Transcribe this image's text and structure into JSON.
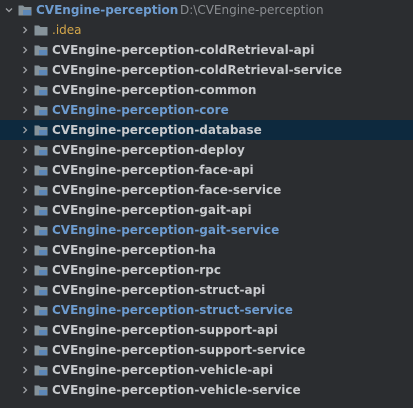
{
  "root": {
    "name": "CVEngine-perception",
    "path": "D:\\CVEngine-perception"
  },
  "items": [
    {
      "label": ".idea",
      "style": "orange",
      "selected": false
    },
    {
      "label": "CVEngine-perception-coldRetrieval-api",
      "style": "normal",
      "selected": false
    },
    {
      "label": "CVEngine-perception-coldRetrieval-service",
      "style": "normal",
      "selected": false
    },
    {
      "label": "CVEngine-perception-common",
      "style": "normal",
      "selected": false
    },
    {
      "label": "CVEngine-perception-core",
      "style": "blue",
      "selected": false
    },
    {
      "label": "CVEngine-perception-database",
      "style": "normal",
      "selected": true
    },
    {
      "label": "CVEngine-perception-deploy",
      "style": "normal",
      "selected": false
    },
    {
      "label": "CVEngine-perception-face-api",
      "style": "normal",
      "selected": false
    },
    {
      "label": "CVEngine-perception-face-service",
      "style": "normal",
      "selected": false
    },
    {
      "label": "CVEngine-perception-gait-api",
      "style": "normal",
      "selected": false
    },
    {
      "label": "CVEngine-perception-gait-service",
      "style": "blue",
      "selected": false
    },
    {
      "label": "CVEngine-perception-ha",
      "style": "normal",
      "selected": false
    },
    {
      "label": "CVEngine-perception-rpc",
      "style": "normal",
      "selected": false
    },
    {
      "label": "CVEngine-perception-struct-api",
      "style": "normal",
      "selected": false
    },
    {
      "label": "CVEngine-perception-struct-service",
      "style": "blue",
      "selected": false
    },
    {
      "label": "CVEngine-perception-support-api",
      "style": "normal",
      "selected": false
    },
    {
      "label": "CVEngine-perception-support-service",
      "style": "normal",
      "selected": false
    },
    {
      "label": "CVEngine-perception-vehicle-api",
      "style": "normal",
      "selected": false
    },
    {
      "label": "CVEngine-perception-vehicle-service",
      "style": "normal",
      "selected": false
    }
  ],
  "icons": {
    "expand": "chevron-down-icon",
    "collapse": "chevron-right-icon",
    "folder": "module-folder-icon",
    "idea_folder": "folder-icon"
  },
  "colors": {
    "background": "#2b2d30",
    "selected_row": "#0d293e",
    "module_text": "#c7c9cc",
    "blue_text": "#6e9ccf",
    "idea_text": "#d3a64a"
  }
}
